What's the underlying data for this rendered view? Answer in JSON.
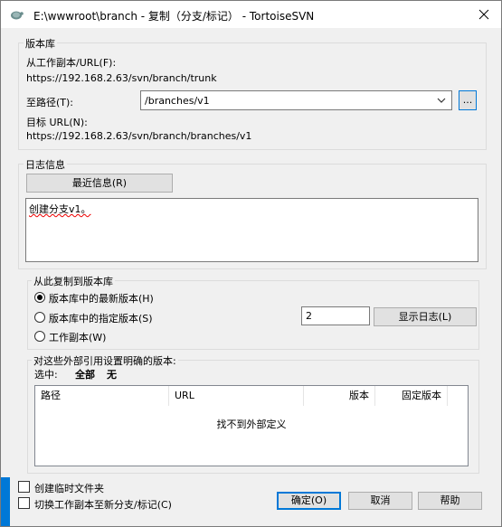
{
  "window": {
    "title": "E:\\wwwroot\\branch - 复制（分支/标记） - TortoiseSVN",
    "close_glyph": "✕"
  },
  "repository": {
    "group_title": "版本库",
    "from_label": "从工作副本/URL(F):",
    "from_url": "https://192.168.2.63/svn/branch/trunk",
    "to_label": "至路径(T):",
    "to_value": "/branches/v1",
    "browse_label": "...",
    "target_label": "目标 URL(N):",
    "target_url": "https://192.168.2.63/svn/branch/branches/v1"
  },
  "log": {
    "group_title": "日志信息",
    "recent_button": "最近信息(R)",
    "message": "创建分支v1。"
  },
  "copy_from": {
    "group_title": "从此复制到版本库",
    "options": [
      {
        "label": "版本库中的最新版本(H)",
        "selected": true
      },
      {
        "label": "版本库中的指定版本(S)",
        "selected": false
      },
      {
        "label": "工作副本(W)",
        "selected": false
      }
    ],
    "revision_value": "2",
    "show_log_button": "显示日志(L)"
  },
  "externals": {
    "group_title": "对这些外部引用设置明确的版本:",
    "select_label": "选中:",
    "select_all": "全部",
    "select_none": "无",
    "columns": [
      "路径",
      "URL",
      "版本",
      "固定版本"
    ],
    "empty_text": "找不到外部定义"
  },
  "footer": {
    "temp_file_label": "创建临时文件夹",
    "switch_label": "切换工作副本至新分支/标记(C)",
    "ok_button": "确定(O)",
    "cancel_button": "取消",
    "help_button": "帮助"
  },
  "colors": {
    "accent": "#0078d7",
    "footer_band": "#0078d7"
  }
}
